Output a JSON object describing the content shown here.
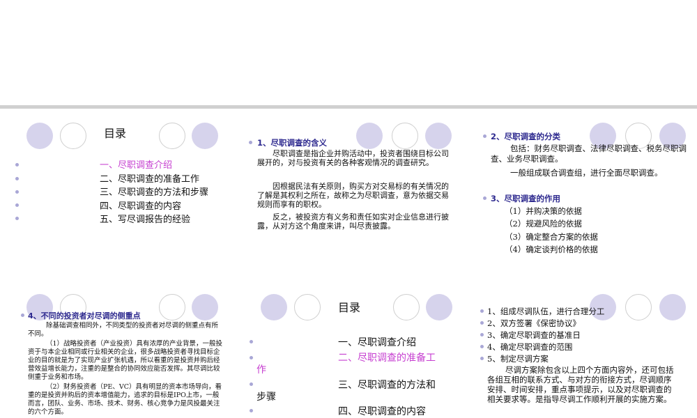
{
  "slide1": {
    "title": "目录",
    "items": [
      "一、尽职调查介绍",
      "二、尽职调查的准备工作",
      "三、尽职调查的方法和步骤",
      "四、尽职调查的内容",
      "五、写尽调报告的经验"
    ],
    "highlight_color": "#c63ed0"
  },
  "slide2": {
    "heading": "1、尽职调查的含义",
    "paragraphs": [
      "尽职调查是指企业并购活动中，投资者围绕目标公司展开的，对与投资有关的各种客观情况的调查研究。",
      "因根据民法有关原则，购买方对交易标的有关情况的了解是其权利之所在，故称之为尽职调查，意为依据交易规则而享有的职权。",
      "反之，被投资方有义务和责任如实对企业信息进行披露，从对方这个角度来讲，叫尽责披露。"
    ]
  },
  "slide3": {
    "heading1": "2、尽职调查的分类",
    "line1": "包括：财务尽职调查、法律尽职调查、税务尽职调查、业务尽职调查。",
    "line2": "一般组成联合调查组，进行全面尽职调查。",
    "heading2": "3、尽职调查的作用",
    "items": [
      "（1）并购决策的依据",
      "（2）规避风险的依据",
      "（3）确定整合方案的依据",
      "（4）确定谈判价格的依据"
    ]
  },
  "slide4": {
    "heading": "4、不同的投资者对尽调的侧重点",
    "paragraphs": [
      "除基础调查相同外，不同类型的投资者对尽调的侧重点有所不同。",
      "（1）战略投资者（产业投资）具有浓厚的产业背景，一般投资于与本企业相同或行业相关的企业，很多战略投资者寻找目标企业的目的就是为了实现产业扩张机遇，所以看重的是投资并购后经营效益增长能力，注重的是整合的协同效应能否发挥。其尽调比较侧重于业务和市场。",
      "（2）财务投资者（PE、VC）具有明显的资本市场导向，看重的是投资并购后的资本增值能力，追求的目标是IPO上市，一般而言，团队、业务、市场、技术、财务、核心竞争力是风投最关注的六个方面。"
    ]
  },
  "slide5": {
    "title": "目录",
    "item1": "一、尽职调查介绍",
    "item2a": "二、尽职调查的准备工",
    "item2b": "作",
    "item3a": "三、尽职调查的方法和",
    "item3b": "步骤",
    "item4": "四、尽职调查的内容"
  },
  "slide6": {
    "items": [
      "1、组成尽调队伍，进行合理分工",
      "2、双方签署《保密协议》",
      "3、确定尽职调查的基准日",
      "4、确定尽职调查的范围",
      "5、制定尽调方案"
    ],
    "paragraph": "尽调方案除包含以上四个方面内容外，还可包括各组互相的联系方式、与对方的衔接方式，尽调顺序安排、时间安排，重点事项提示，以及对尽职调查的相关要求等。是指导尽调工作顺利开展的实施方案。"
  }
}
